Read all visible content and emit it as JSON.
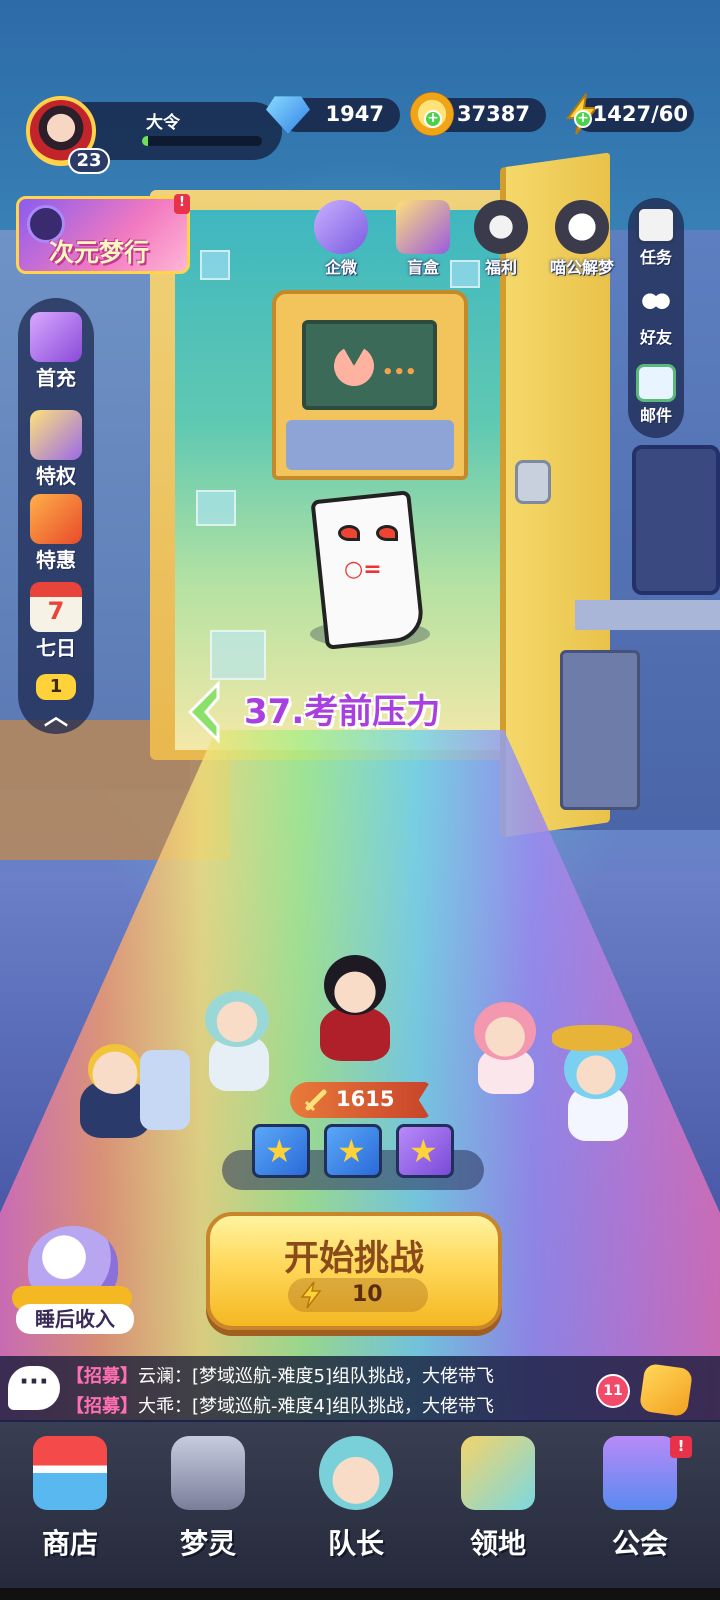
{
  "player": {
    "name": "大令",
    "level": "23",
    "xp_fraction": 0.05
  },
  "resources": {
    "gems": "1947",
    "coins": "37387",
    "energy": "1427/60"
  },
  "event_banner": {
    "label": "次元梦行",
    "badge": "!"
  },
  "top_icons": [
    {
      "label": "企微",
      "icon": "gift-box-icon"
    },
    {
      "label": "盲盒",
      "icon": "mystery-card-icon"
    },
    {
      "label": "福利",
      "icon": "welfare-gift-icon"
    },
    {
      "label": "喵公解梦",
      "icon": "cat-mascot-icon"
    }
  ],
  "left_menu": [
    {
      "label": "首充",
      "icon": "hammer-icon"
    },
    {
      "label": "特权",
      "icon": "privilege-cards-icon"
    },
    {
      "label": "特惠",
      "icon": "discount-box-icon"
    },
    {
      "label": "七日",
      "icon": "calendar-icon",
      "calendar_day": "7"
    }
  ],
  "left_menu_extra": {
    "rank_badge": "1",
    "icon": "chevron-up-icon"
  },
  "right_menu": [
    {
      "label": "任务",
      "icon": "task-clipboard-icon"
    },
    {
      "label": "好友",
      "icon": "friends-icon"
    },
    {
      "label": "邮件",
      "icon": "mail-icon"
    }
  ],
  "stage": {
    "title": "37.考前压力"
  },
  "team": {
    "power": "1615",
    "reward_slots": [
      "star-chest-icon",
      "star-chest-icon",
      "star-chest-icon"
    ]
  },
  "start_button": {
    "label": "开始挑战",
    "energy_cost": "10"
  },
  "idle_reward": {
    "label": "睡后收入"
  },
  "chat": {
    "lines": [
      {
        "tag": "【招募】",
        "who": "云澜：",
        "msg": "[梦域巡航-难度5]组队挑战，大佬带飞"
      },
      {
        "tag": "【招募】",
        "who": "大乖：",
        "msg": "[梦域巡航-难度4]组队挑战，大佬带飞"
      }
    ],
    "icon_text": "···",
    "unread": "11"
  },
  "bottom_nav": [
    {
      "label": "商店",
      "icon": "shop-icon"
    },
    {
      "label": "梦灵",
      "icon": "dream-spirit-icon"
    },
    {
      "label": "队长",
      "icon": "captain-icon"
    },
    {
      "label": "领地",
      "icon": "territory-icon"
    },
    {
      "label": "公会",
      "icon": "guild-icon",
      "badge": "!"
    }
  ],
  "colors": {
    "accent_yellow": "#ffd85a",
    "stage_title": "#a93fe0",
    "chat_tag": "#ff6fb3",
    "panel_bg": "#1e2850"
  }
}
